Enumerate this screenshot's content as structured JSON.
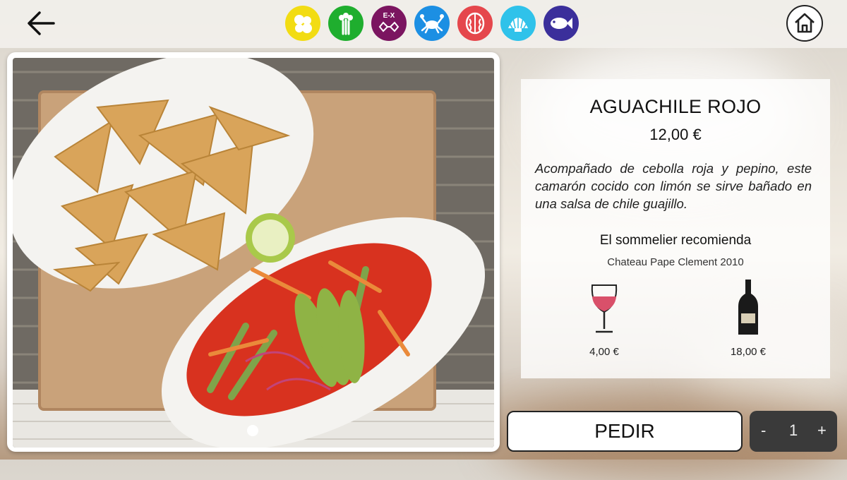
{
  "top_bar": {
    "back_icon": "arrow-left-icon",
    "home_icon": "home-icon",
    "allergens": [
      {
        "name": "eggs-allergen-icon",
        "color": "#f2dc13"
      },
      {
        "name": "celery-allergen-icon",
        "color": "#1fae2e"
      },
      {
        "name": "sulphites-allergen-icon",
        "color": "#7b1560",
        "label": "E-X"
      },
      {
        "name": "crustaceans-allergen-icon",
        "color": "#1c8fe3"
      },
      {
        "name": "nuts-allergen-icon",
        "color": "#e5474c"
      },
      {
        "name": "molluscs-allergen-icon",
        "color": "#2fc2ea"
      },
      {
        "name": "fish-allergen-icon",
        "color": "#3b2f9b"
      }
    ]
  },
  "dish": {
    "name": "AGUACHILE ROJO",
    "price": "12,00 €",
    "description": "Acompañado de cebolla roja y pepino, este camarón cocido con limón se sirve bañado en una salsa de chile guajillo.",
    "image_icon": "dish-photo-image"
  },
  "sommelier": {
    "heading": "El sommelier recomienda",
    "wine": "Chateau Pape Clement 2010",
    "glass_price": "4,00 €",
    "bottle_price": "18,00 €",
    "glass_icon": "wine-glass-icon",
    "bottle_icon": "wine-bottle-icon"
  },
  "order": {
    "button": "PEDIR",
    "minus": "-",
    "quantity": "1",
    "plus": "+"
  }
}
